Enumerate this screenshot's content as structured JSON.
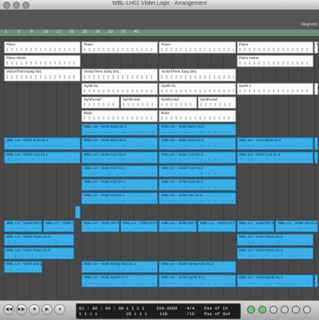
{
  "window": {
    "title": "WBL-LH01 Violet Logic - Arrangement"
  },
  "ruler": {
    "marker_label": "Magnetic",
    "bars": [
      "1",
      "5",
      "9",
      "13",
      "17",
      "21",
      "25",
      "29",
      "33",
      "37",
      "41"
    ]
  },
  "tracks": [
    {
      "row": 0,
      "regions": [
        {
          "label": "Piano",
          "kind": "midi",
          "start": 1,
          "end": 25
        },
        {
          "label": "Piano",
          "kind": "midi",
          "start": 25,
          "end": 49
        },
        {
          "label": "Piano",
          "kind": "midi",
          "start": 49,
          "end": 73
        },
        {
          "label": "Piano",
          "kind": "midi",
          "start": 73,
          "end": 97
        },
        {
          "label": "Piano",
          "kind": "midi",
          "start": 97,
          "end": 100
        }
      ]
    },
    {
      "row": 1,
      "regions": [
        {
          "label": "Piano Heme",
          "kind": "midi",
          "start": 1,
          "end": 25
        },
        {
          "label": "Piano Heme",
          "kind": "midi",
          "start": 73,
          "end": 97
        }
      ]
    },
    {
      "row": 2,
      "regions": [
        {
          "label": "Violon/Trem Easy 001",
          "kind": "midi",
          "start": 1,
          "end": 25
        },
        {
          "label": "Violon/Trem Easy 001",
          "kind": "midi",
          "start": 25,
          "end": 49
        },
        {
          "label": "Violon/Trem Easy 001",
          "kind": "midi",
          "start": 49,
          "end": 73
        }
      ]
    },
    {
      "row": 3,
      "regions": [
        {
          "label": "Synth 01",
          "kind": "midi",
          "start": 25,
          "end": 49
        },
        {
          "label": "Synth 01",
          "kind": "midi",
          "start": 49,
          "end": 73
        },
        {
          "label": "Synth 2",
          "kind": "midi",
          "start": 73,
          "end": 97
        },
        {
          "label": "",
          "kind": "midi",
          "start": 97,
          "end": 100
        }
      ]
    },
    {
      "row": 4,
      "regions": [
        {
          "label": "SynthLead",
          "kind": "midi",
          "start": 25,
          "end": 37
        },
        {
          "label": "SynthLead",
          "kind": "midi",
          "start": 37,
          "end": 49
        },
        {
          "label": "SynthLead",
          "kind": "midi",
          "start": 49,
          "end": 61
        },
        {
          "label": "SynthLead",
          "kind": "midi",
          "start": 61,
          "end": 73
        }
      ]
    },
    {
      "row": 5,
      "regions": [
        {
          "label": "Bass",
          "kind": "midi",
          "start": 25,
          "end": 49
        },
        {
          "label": "Bass",
          "kind": "midi",
          "start": 49,
          "end": 73
        }
      ]
    },
    {
      "row": 6,
      "regions": [
        {
          "label": "WBL-LH - Violet Bass 01.1",
          "kind": "audio",
          "start": 25,
          "end": 49
        },
        {
          "label": "WBL-LH - Violet Bass 01.2",
          "kind": "audio",
          "start": 49,
          "end": 73
        }
      ]
    },
    {
      "row": 7,
      "regions": [
        {
          "label": "WBL-LH - Violet Beat 01.1",
          "kind": "audio",
          "start": 1,
          "end": 25
        },
        {
          "label": "WBL-LH - Violet Beat 01.2",
          "kind": "audio",
          "start": 25,
          "end": 49
        },
        {
          "label": "WBL-LH - Violet Beat 01.3",
          "kind": "audio",
          "start": 49,
          "end": 73
        },
        {
          "label": "WBL-LH - Violet Beat 01.4",
          "kind": "audio",
          "start": 73,
          "end": 97
        },
        {
          "label": "",
          "kind": "audio",
          "start": 97,
          "end": 100
        }
      ]
    },
    {
      "row": 8,
      "regions": [
        {
          "label": "WBL-LH - Violet Curt 01.1",
          "kind": "audio",
          "start": 1,
          "end": 25
        },
        {
          "label": "WBL-LH - Violet Curt 01.2",
          "kind": "audio",
          "start": 25,
          "end": 49
        },
        {
          "label": "WBL-LH - Violet Curt 01.3",
          "kind": "audio",
          "start": 49,
          "end": 73
        },
        {
          "label": "WBL-LH - Violet Curt 01.4",
          "kind": "audio",
          "start": 73,
          "end": 97
        },
        {
          "label": "",
          "kind": "audio",
          "start": 97,
          "end": 100
        }
      ]
    },
    {
      "row": 9,
      "regions": [
        {
          "label": "WBL-LH - Violet Curt 01.1",
          "kind": "audio",
          "start": 25,
          "end": 49
        },
        {
          "label": "WBL-LH - Violet Curt 01.2",
          "kind": "audio",
          "start": 49,
          "end": 73
        }
      ]
    },
    {
      "row": 10,
      "regions": [
        {
          "label": "WBL-LH - Violet Curt 01.1",
          "kind": "audio",
          "start": 25,
          "end": 49
        },
        {
          "label": "WBL-LH - Violet Curt 01.2",
          "kind": "audio",
          "start": 49,
          "end": 73
        }
      ]
    },
    {
      "row": 11,
      "regions": [
        {
          "label": "WBL-LH - Violet Vox 01.1",
          "kind": "audio",
          "start": 25,
          "end": 49
        },
        {
          "label": "WBL-LH - Violet Vox 01.2",
          "kind": "audio",
          "start": 49,
          "end": 73
        }
      ]
    },
    {
      "row": 12,
      "regions": [
        {
          "label": "",
          "kind": "audio",
          "start": 23,
          "end": 25
        }
      ]
    },
    {
      "row": 13,
      "regions": [
        {
          "label": "WBL-LH - Violet HH 01.1",
          "kind": "audio",
          "start": 1,
          "end": 13
        },
        {
          "label": "WBL-LH - Violet HH 01.2",
          "kind": "audio",
          "start": 13,
          "end": 23
        },
        {
          "label": "WBL-LH - Violet HH 01.3",
          "kind": "audio",
          "start": 25,
          "end": 37
        },
        {
          "label": "WBL-LH - Violet HH 01.4",
          "kind": "audio",
          "start": 37,
          "end": 49
        },
        {
          "label": "WBL-LH - Violet HH 01.5",
          "kind": "audio",
          "start": 49,
          "end": 61
        },
        {
          "label": "WBL-LH - Violet HH 01.6",
          "kind": "audio",
          "start": 61,
          "end": 73
        },
        {
          "label": "WBL-LH - Violet HH 01.7",
          "kind": "audio",
          "start": 73,
          "end": 85
        },
        {
          "label": "WBL-LH - Violet HH 01.8",
          "kind": "audio",
          "start": 85,
          "end": 100
        }
      ]
    },
    {
      "row": 14,
      "regions": [
        {
          "label": "WBL-LH - Violet Piano 01.1",
          "kind": "audio",
          "start": 1,
          "end": 23
        },
        {
          "label": "WBL-LH - Violet Piano 01.2",
          "kind": "audio",
          "start": 73,
          "end": 97
        }
      ]
    },
    {
      "row": 15,
      "regions": [
        {
          "label": "WBL-LH - Violet Piano 01.3",
          "kind": "audio",
          "start": 1,
          "end": 23
        },
        {
          "label": "WBL-LH - Violet Piano 01.4",
          "kind": "audio",
          "start": 73,
          "end": 97
        }
      ]
    },
    {
      "row": 16,
      "regions": [
        {
          "label": "WBL-LH - Violet String Intro 01.1",
          "kind": "audio",
          "start": 1,
          "end": 13
        },
        {
          "label": "WBL-LH - Violet String Intro 01.1",
          "kind": "audio",
          "start": 25,
          "end": 49
        },
        {
          "label": "WBL-LH - Violet String Intro 01.2",
          "kind": "audio",
          "start": 49,
          "end": 73
        }
      ]
    },
    {
      "row": 17,
      "regions": [
        {
          "label": "WBL-LH - Violet Synth 01.1",
          "kind": "audio",
          "start": 25,
          "end": 49
        },
        {
          "label": "WBL-LH - Violet Synth 01.2",
          "kind": "audio",
          "start": 49,
          "end": 73
        },
        {
          "label": "WBL-LH - Violet Synth 01.3",
          "kind": "audio",
          "start": 73,
          "end": 97
        },
        {
          "label": "",
          "kind": "audio",
          "start": 97,
          "end": 100
        }
      ]
    }
  ],
  "transport": {
    "position_smpte": "01 : 00 : 00 : 00",
    "position_bars": "1  1  1  1",
    "smpte_sub": "1  1  1  1",
    "bars_sub": "26  1  1  1",
    "tempo": "100.0000",
    "division": "130",
    "sig_top": "4/4",
    "sig_bottom": "/16",
    "in_label": "Pas of In",
    "out_label": "Pas of Out"
  },
  "colors": {
    "midi_region": "#fbfbfb",
    "audio_region": "#3ab0e8",
    "ruler": "#6d8f78"
  }
}
